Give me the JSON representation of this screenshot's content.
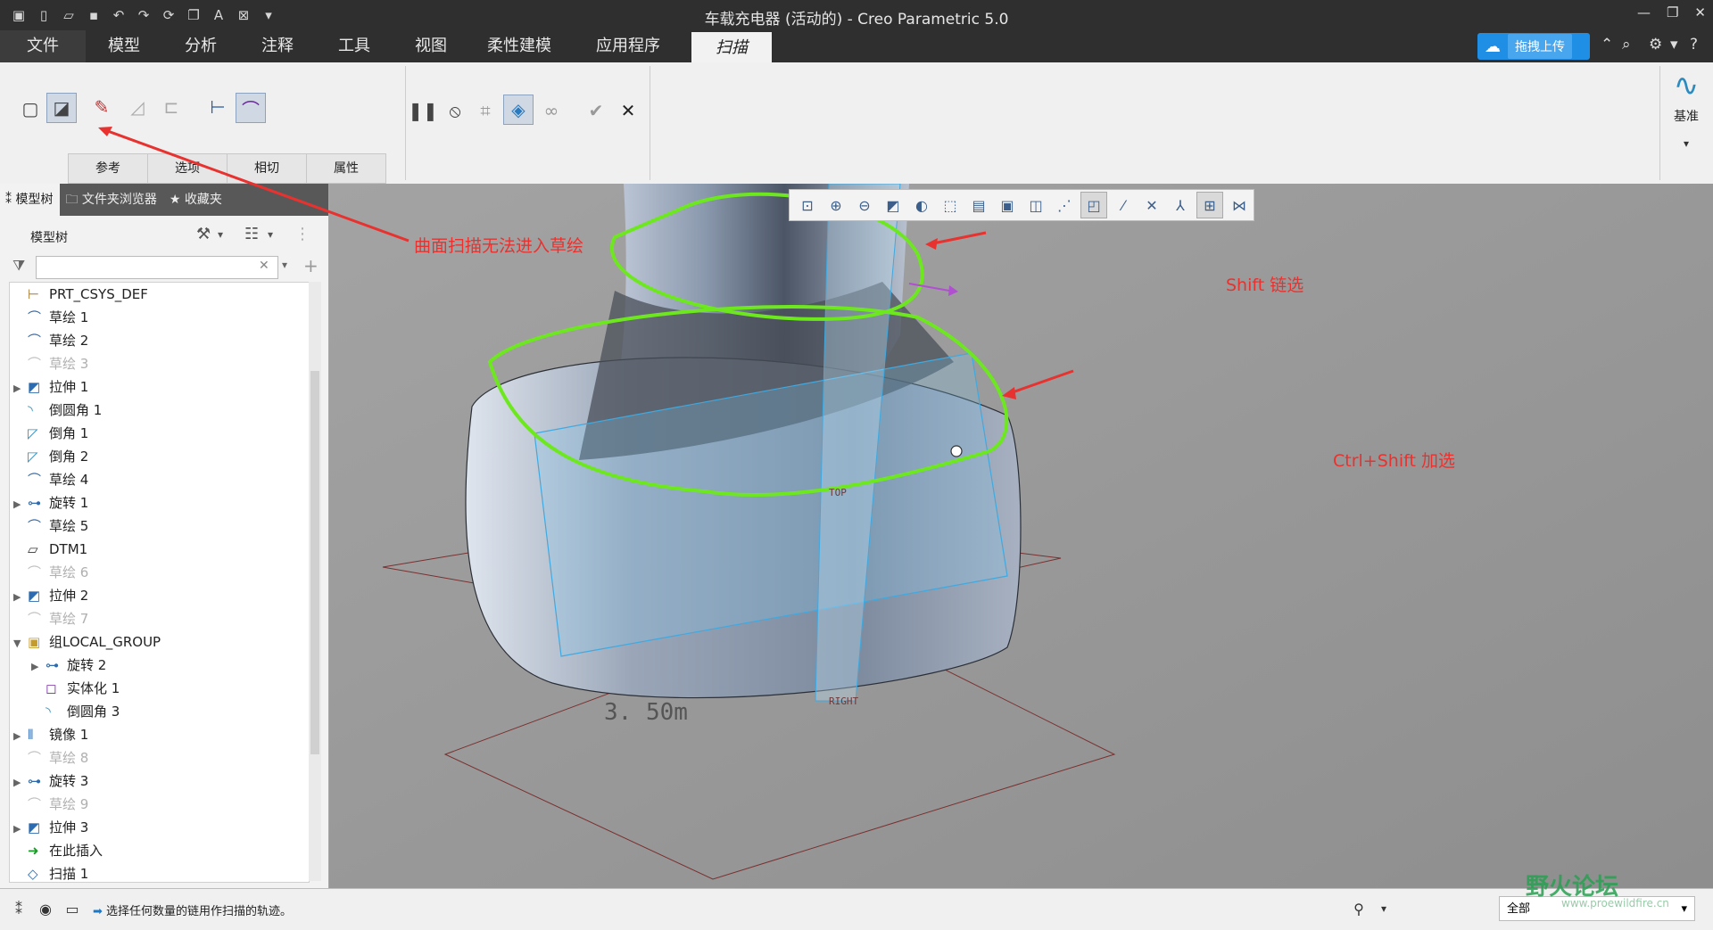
{
  "window": {
    "title": "车载充电器 (活动的) - Creo Parametric 5.0",
    "controls": [
      "—",
      "❐",
      "✕"
    ]
  },
  "quick_access": [
    "new-icon",
    "open-icon",
    "save-icon",
    "undo-icon",
    "redo-icon",
    "regenerate-icon",
    "windows-icon",
    "text-icon",
    "close-window-icon",
    "customize-icon"
  ],
  "menu": {
    "items": [
      "文件",
      "模型",
      "分析",
      "注释",
      "工具",
      "视图",
      "柔性建模",
      "应用程序",
      "扫描"
    ],
    "active": "扫描",
    "upload_label": "拖拽上传"
  },
  "ribbon": {
    "tabs": [
      "参考",
      "选项",
      "相切",
      "属性"
    ],
    "datum_label": "基准"
  },
  "panel": {
    "tabs": [
      "模型树",
      "文件夹浏览器",
      "收藏夹"
    ],
    "tree_title": "模型树",
    "filter_placeholder": ""
  },
  "tree": [
    {
      "label": "PRT_CSYS_DEF",
      "icon": "csys",
      "dim": false,
      "expand": "",
      "indent": 0
    },
    {
      "label": "草绘 1",
      "icon": "sketch",
      "dim": false,
      "expand": "",
      "indent": 0
    },
    {
      "label": "草绘 2",
      "icon": "sketch",
      "dim": false,
      "expand": "",
      "indent": 0
    },
    {
      "label": "草绘 3",
      "icon": "sketch",
      "dim": true,
      "expand": "",
      "indent": 0
    },
    {
      "label": "拉伸 1",
      "icon": "extrude",
      "dim": false,
      "expand": "▶",
      "indent": 0
    },
    {
      "label": "倒圆角 1",
      "icon": "round",
      "dim": false,
      "expand": "",
      "indent": 0
    },
    {
      "label": "倒角 1",
      "icon": "chamfer",
      "dim": false,
      "expand": "",
      "indent": 0
    },
    {
      "label": "倒角 2",
      "icon": "chamfer",
      "dim": false,
      "expand": "",
      "indent": 0
    },
    {
      "label": "草绘 4",
      "icon": "sketch",
      "dim": false,
      "expand": "",
      "indent": 0
    },
    {
      "label": "旋转 1",
      "icon": "revolve",
      "dim": false,
      "expand": "▶",
      "indent": 0
    },
    {
      "label": "草绘 5",
      "icon": "sketch",
      "dim": false,
      "expand": "",
      "indent": 0
    },
    {
      "label": "DTM1",
      "icon": "plane",
      "dim": false,
      "expand": "",
      "indent": 0
    },
    {
      "label": "草绘 6",
      "icon": "sketch",
      "dim": true,
      "expand": "",
      "indent": 0
    },
    {
      "label": "拉伸 2",
      "icon": "extrude",
      "dim": false,
      "expand": "▶",
      "indent": 0
    },
    {
      "label": "草绘 7",
      "icon": "sketch",
      "dim": true,
      "expand": "",
      "indent": 0
    },
    {
      "label": "组LOCAL_GROUP",
      "icon": "group",
      "dim": false,
      "expand": "▼",
      "indent": 0
    },
    {
      "label": "旋转 2",
      "icon": "revolve",
      "dim": false,
      "expand": "▶",
      "indent": 1
    },
    {
      "label": "实体化 1",
      "icon": "solidify",
      "dim": false,
      "expand": "",
      "indent": 1
    },
    {
      "label": "倒圆角 3",
      "icon": "round",
      "dim": false,
      "expand": "",
      "indent": 1
    },
    {
      "label": "镜像 1",
      "icon": "mirror",
      "dim": false,
      "expand": "▶",
      "indent": 0
    },
    {
      "label": "草绘 8",
      "icon": "sketch",
      "dim": true,
      "expand": "",
      "indent": 0
    },
    {
      "label": "旋转 3",
      "icon": "revolve",
      "dim": false,
      "expand": "▶",
      "indent": 0
    },
    {
      "label": "草绘 9",
      "icon": "sketch",
      "dim": true,
      "expand": "",
      "indent": 0
    },
    {
      "label": "拉伸 3",
      "icon": "extrude",
      "dim": false,
      "expand": "▶",
      "indent": 0
    },
    {
      "label": "在此插入",
      "icon": "insert",
      "dim": false,
      "expand": "",
      "indent": 0
    },
    {
      "label": "扫描 1",
      "icon": "sweep",
      "dim": false,
      "expand": "",
      "indent": 0
    }
  ],
  "annotations": {
    "sketch_note": "曲面扫描无法进入草绘",
    "shift_note": "Shift 链选",
    "ctrl_shift_note": "Ctrl+Shift 加选"
  },
  "viewport_labels": {
    "top": "TOP",
    "right": "RIGHT",
    "dimension": "3. 50m"
  },
  "status": {
    "message": "选择任何数量的链用作扫描的轨迹。",
    "filter_value": "全部"
  },
  "watermark": {
    "name": "野火论坛",
    "url": "www.proewildfire.cn"
  },
  "colors": {
    "chain_green": "#6ee81e",
    "annotation_red": "#e8322f",
    "datum_blue": "#3fa9e0",
    "upload_blue": "#1f8fe6"
  }
}
